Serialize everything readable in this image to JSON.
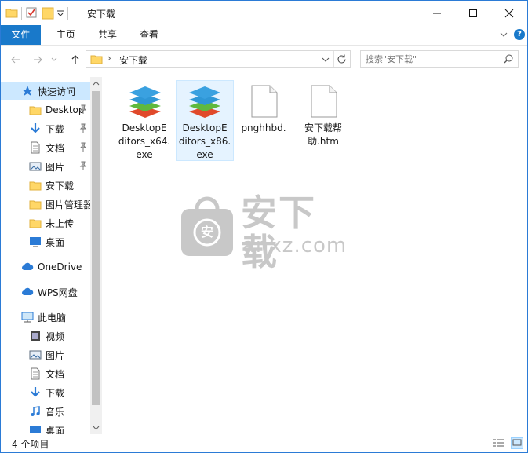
{
  "window": {
    "title": "安下载",
    "minimize_glyph": "—",
    "maximize_glyph": "☐",
    "close_glyph": "✕"
  },
  "ribbon": {
    "tabs": [
      {
        "label": "文件"
      },
      {
        "label": "主页"
      },
      {
        "label": "共享"
      },
      {
        "label": "查看"
      }
    ],
    "expand_glyph": "⌄",
    "help_glyph": "?"
  },
  "address": {
    "back_glyph": "←",
    "forward_glyph": "→",
    "recent_glyph": "⌄",
    "up_glyph": "↑",
    "chevron": "›",
    "path": "安下载",
    "dropdown_glyph": "⌄",
    "refresh_glyph": "↻"
  },
  "search": {
    "placeholder": "搜索\"安下载\"",
    "icon": "search-icon"
  },
  "nav": {
    "items": [
      {
        "label": "快速访问",
        "icon": "star-icon",
        "pinned": false
      },
      {
        "label": "Desktop",
        "icon": "folder-icon",
        "pinned": true
      },
      {
        "label": "下载",
        "icon": "download-icon",
        "pinned": true
      },
      {
        "label": "文档",
        "icon": "document-icon",
        "pinned": true
      },
      {
        "label": "图片",
        "icon": "picture-icon",
        "pinned": true
      },
      {
        "label": "安下载",
        "icon": "folder-icon",
        "pinned": false
      },
      {
        "label": "图片管理器",
        "icon": "folder-icon",
        "pinned": false
      },
      {
        "label": "未上传",
        "icon": "folder-icon",
        "pinned": false
      },
      {
        "label": "桌面",
        "icon": "desktop-icon",
        "pinned": false
      },
      {
        "label": "OneDrive",
        "icon": "cloud-icon",
        "pinned": false
      },
      {
        "label": "WPS网盘",
        "icon": "cloud-icon",
        "pinned": false
      },
      {
        "label": "此电脑",
        "icon": "computer-icon",
        "pinned": false
      },
      {
        "label": "视频",
        "icon": "video-icon",
        "pinned": false
      },
      {
        "label": "图片",
        "icon": "picture-icon",
        "pinned": false
      },
      {
        "label": "文档",
        "icon": "document-icon",
        "pinned": false
      },
      {
        "label": "下载",
        "icon": "download-icon",
        "pinned": false
      },
      {
        "label": "音乐",
        "icon": "music-icon",
        "pinned": false
      },
      {
        "label": "桌面",
        "icon": "desktop-icon",
        "pinned": false
      }
    ],
    "pin_glyph": "📌",
    "scroll_up_glyph": "⌃",
    "scroll_down_glyph": "⌄"
  },
  "files": [
    {
      "name": "DesktopEditors_x64.exe",
      "line1": "DesktopE",
      "line2": "ditors_x64.",
      "line3": "exe",
      "icon": "onlyoffice-installer-icon"
    },
    {
      "name": "DesktopEditors_x86.exe",
      "line1": "DesktopE",
      "line2": "ditors_x86.",
      "line3": "exe",
      "icon": "onlyoffice-installer-icon"
    },
    {
      "name": "pnghhbd.",
      "line1": "pnghhbd.",
      "line2": "",
      "line3": "",
      "icon": "blank-file-icon"
    },
    {
      "name": "安下载帮助.htm",
      "line1": "安下载帮",
      "line2": "助.htm",
      "line3": "",
      "icon": "blank-file-icon"
    }
  ],
  "watermark": {
    "text_cn": "安下载",
    "text_en": "anxz.com",
    "badge_char": "安"
  },
  "status": {
    "count_text": "4 个项目"
  },
  "colors": {
    "accent": "#1979ca",
    "selection": "#cce8ff",
    "hover": "#e5f3ff",
    "folder": "#ffd767"
  }
}
